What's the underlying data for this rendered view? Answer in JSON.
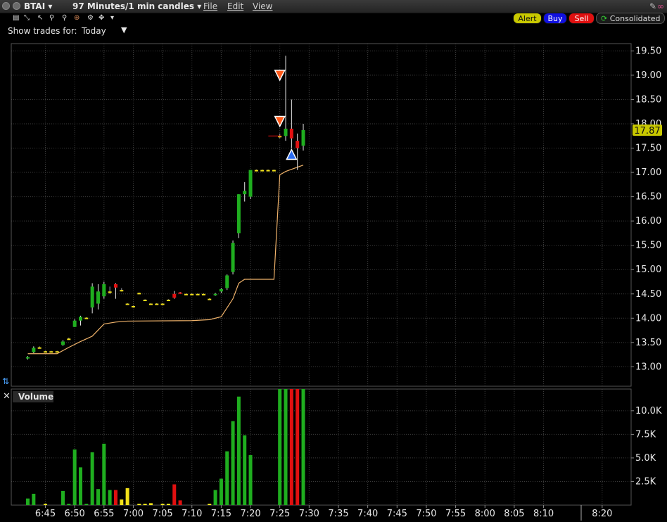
{
  "window": {
    "symbol": "BTAI",
    "period": "97 Minutes/1 min candles",
    "menus": [
      "File",
      "Edit",
      "View"
    ]
  },
  "actions": {
    "alert": "Alert",
    "buy": "Buy",
    "sell": "Sell",
    "consolidated": "Consolidated"
  },
  "show_trades": {
    "label": "Show trades for:",
    "value": "Today"
  },
  "volume_panel": {
    "title": "Volume"
  },
  "colors": {
    "up": "#1fae1f",
    "down": "#e01010",
    "flat": "#f2e11a",
    "vwap": "#f0b36b",
    "grid": "#3c3c3c",
    "alert_btn": "#c8c800",
    "buy_btn": "#1010e0",
    "sell_btn": "#e01010",
    "last_price_bg": "#c8c800"
  },
  "chart_data": [
    {
      "type": "candlestick",
      "title": "BTAI",
      "price_axis": {
        "ylim": [
          12.6,
          19.65
        ],
        "ticks": [
          "19.50",
          "19.00",
          "18.50",
          "18.00",
          "17.50",
          "17.00",
          "16.50",
          "16.00",
          "15.50",
          "15.00",
          "14.50",
          "14.00",
          "13.50",
          "13.00"
        ]
      },
      "last_price": "17.87",
      "time_axis": {
        "ticks": [
          "6:45",
          "6:50",
          "6:55",
          "7:00",
          "7:05",
          "7:10",
          "7:15",
          "7:20",
          "7:25",
          "7:30",
          "7:35",
          "7:40",
          "7:45",
          "7:50",
          "7:55",
          "8:00",
          "8:05",
          "8:10",
          "8:20"
        ]
      },
      "candles": [
        {
          "t": "6:42",
          "o": 13.17,
          "h": 13.22,
          "l": 13.15,
          "c": 13.2
        },
        {
          "t": "6:43",
          "o": 13.3,
          "h": 13.42,
          "l": 13.28,
          "c": 13.39
        },
        {
          "t": "6:44",
          "o": 13.4,
          "h": 13.42,
          "l": 13.38,
          "c": 13.4
        },
        {
          "t": "6:45",
          "o": 13.32,
          "h": 13.33,
          "l": 13.31,
          "c": 13.32
        },
        {
          "t": "6:46",
          "o": 13.32,
          "h": 13.33,
          "l": 13.31,
          "c": 13.32
        },
        {
          "t": "6:47",
          "o": 13.32,
          "h": 13.33,
          "l": 13.31,
          "c": 13.32
        },
        {
          "t": "6:48",
          "o": 13.45,
          "h": 13.55,
          "l": 13.43,
          "c": 13.52
        },
        {
          "t": "6:49",
          "o": 13.58,
          "h": 13.6,
          "l": 13.56,
          "c": 13.58
        },
        {
          "t": "6:50",
          "o": 13.82,
          "h": 13.98,
          "l": 13.82,
          "c": 13.95
        },
        {
          "t": "6:51",
          "o": 13.95,
          "h": 14.05,
          "l": 13.85,
          "c": 14.03
        },
        {
          "t": "6:52",
          "o": 14.01,
          "h": 14.02,
          "l": 14.0,
          "c": 14.01
        },
        {
          "t": "6:53",
          "o": 14.22,
          "h": 14.72,
          "l": 14.1,
          "c": 14.65
        },
        {
          "t": "6:54",
          "o": 14.3,
          "h": 14.7,
          "l": 14.18,
          "c": 14.55
        },
        {
          "t": "6:55",
          "o": 14.45,
          "h": 14.75,
          "l": 14.4,
          "c": 14.7
        },
        {
          "t": "6:56",
          "o": 14.55,
          "h": 14.65,
          "l": 14.5,
          "c": 14.55
        },
        {
          "t": "6:57",
          "o": 14.7,
          "h": 14.72,
          "l": 14.4,
          "c": 14.63
        },
        {
          "t": "6:58",
          "o": 14.58,
          "h": 14.62,
          "l": 14.55,
          "c": 14.58
        },
        {
          "t": "6:59",
          "o": 14.3,
          "h": 14.31,
          "l": 14.29,
          "c": 14.3
        },
        {
          "t": "7:00",
          "o": 14.25,
          "h": 14.26,
          "l": 14.24,
          "c": 14.25
        },
        {
          "t": "7:01",
          "o": 14.52,
          "h": 14.53,
          "l": 14.51,
          "c": 14.52
        },
        {
          "t": "7:02",
          "o": 14.38,
          "h": 14.39,
          "l": 14.37,
          "c": 14.38
        },
        {
          "t": "7:03",
          "o": 14.3,
          "h": 14.31,
          "l": 14.29,
          "c": 14.3
        },
        {
          "t": "7:04",
          "o": 14.3,
          "h": 14.31,
          "l": 14.29,
          "c": 14.3
        },
        {
          "t": "7:05",
          "o": 14.3,
          "h": 14.31,
          "l": 14.29,
          "c": 14.3
        },
        {
          "t": "7:06",
          "o": 14.38,
          "h": 14.39,
          "l": 14.37,
          "c": 14.38
        },
        {
          "t": "7:07",
          "o": 14.5,
          "h": 14.56,
          "l": 14.4,
          "c": 14.42
        },
        {
          "t": "7:08",
          "o": 14.53,
          "h": 14.54,
          "l": 14.5,
          "c": 14.51
        },
        {
          "t": "7:09",
          "o": 14.5,
          "h": 14.51,
          "l": 14.49,
          "c": 14.5
        },
        {
          "t": "7:10",
          "o": 14.5,
          "h": 14.51,
          "l": 14.49,
          "c": 14.5
        },
        {
          "t": "7:11",
          "o": 14.5,
          "h": 14.51,
          "l": 14.49,
          "c": 14.5
        },
        {
          "t": "7:12",
          "o": 14.5,
          "h": 14.51,
          "l": 14.49,
          "c": 14.5
        },
        {
          "t": "7:13",
          "o": 14.4,
          "h": 14.41,
          "l": 14.39,
          "c": 14.4
        },
        {
          "t": "7:14",
          "o": 14.48,
          "h": 14.52,
          "l": 14.46,
          "c": 14.5
        },
        {
          "t": "7:15",
          "o": 14.55,
          "h": 14.62,
          "l": 14.52,
          "c": 14.6
        },
        {
          "t": "7:16",
          "o": 14.62,
          "h": 14.9,
          "l": 14.58,
          "c": 14.88
        },
        {
          "t": "7:17",
          "o": 14.95,
          "h": 15.6,
          "l": 14.9,
          "c": 15.55
        },
        {
          "t": "7:18",
          "o": 15.75,
          "h": 16.55,
          "l": 15.65,
          "c": 16.55
        },
        {
          "t": "7:19",
          "o": 16.55,
          "h": 16.8,
          "l": 16.4,
          "c": 16.62
        },
        {
          "t": "7:20",
          "o": 16.5,
          "h": 17.05,
          "l": 16.45,
          "c": 17.05
        },
        {
          "t": "7:21",
          "o": 17.05,
          "h": 17.06,
          "l": 17.04,
          "c": 17.05
        },
        {
          "t": "7:22",
          "o": 17.05,
          "h": 17.06,
          "l": 17.04,
          "c": 17.05
        },
        {
          "t": "7:23",
          "o": 17.05,
          "h": 17.06,
          "l": 17.04,
          "c": 17.05
        },
        {
          "t": "7:24",
          "o": 17.05,
          "h": 17.06,
          "l": 17.04,
          "c": 17.05
        },
        {
          "t": "7:25",
          "o": 17.75,
          "h": 17.8,
          "l": 17.7,
          "c": 17.75
        },
        {
          "t": "7:26",
          "o": 17.75,
          "h": 19.4,
          "l": 17.65,
          "c": 17.9
        },
        {
          "t": "7:27",
          "o": 17.9,
          "h": 18.5,
          "l": 17.5,
          "c": 17.7
        },
        {
          "t": "7:28",
          "o": 17.65,
          "h": 17.8,
          "l": 17.05,
          "c": 17.5
        },
        {
          "t": "7:29",
          "o": 17.55,
          "h": 18.0,
          "l": 17.45,
          "c": 17.87
        }
      ],
      "vwap": [
        {
          "t": "6:42",
          "v": 13.27
        },
        {
          "t": "6:47",
          "v": 13.27
        },
        {
          "t": "6:49",
          "v": 13.4
        },
        {
          "t": "6:51",
          "v": 13.52
        },
        {
          "t": "6:53",
          "v": 13.63
        },
        {
          "t": "6:55",
          "v": 13.88
        },
        {
          "t": "6:57",
          "v": 13.92
        },
        {
          "t": "6:59",
          "v": 13.94
        },
        {
          "t": "7:10",
          "v": 13.95
        },
        {
          "t": "7:13",
          "v": 13.97
        },
        {
          "t": "7:15",
          "v": 14.03
        },
        {
          "t": "7:17",
          "v": 14.4
        },
        {
          "t": "7:18",
          "v": 14.72
        },
        {
          "t": "7:19",
          "v": 14.8
        },
        {
          "t": "7:24",
          "v": 14.8
        },
        {
          "t": "7:25",
          "v": 16.95
        },
        {
          "t": "7:26",
          "v": 17.02
        },
        {
          "t": "7:29",
          "v": 17.15
        }
      ],
      "trade_markers": [
        {
          "side": "sell",
          "t": "7:25",
          "price": 19.0
        },
        {
          "side": "sell",
          "t": "7:25",
          "price": 18.05
        },
        {
          "side": "buy",
          "t": "7:27",
          "price": 17.37
        }
      ]
    },
    {
      "type": "bar",
      "title": "Volume",
      "y_axis": {
        "ylim": [
          0,
          12300
        ],
        "ticks": [
          "10.0K",
          "7.5K",
          "5.0K",
          "2.5K"
        ]
      },
      "bars": [
        {
          "t": "6:42",
          "v": 700,
          "dir": "up"
        },
        {
          "t": "6:43",
          "v": 1200,
          "dir": "up"
        },
        {
          "t": "6:44",
          "v": 0,
          "dir": "up"
        },
        {
          "t": "6:45",
          "v": 150,
          "dir": "flat"
        },
        {
          "t": "6:46",
          "v": 0,
          "dir": "up"
        },
        {
          "t": "6:47",
          "v": 0,
          "dir": "up"
        },
        {
          "t": "6:48",
          "v": 1500,
          "dir": "up"
        },
        {
          "t": "6:49",
          "v": 150,
          "dir": "up"
        },
        {
          "t": "6:50",
          "v": 5900,
          "dir": "up"
        },
        {
          "t": "6:51",
          "v": 4000,
          "dir": "up"
        },
        {
          "t": "6:52",
          "v": 150,
          "dir": "up"
        },
        {
          "t": "6:53",
          "v": 5600,
          "dir": "up"
        },
        {
          "t": "6:54",
          "v": 1700,
          "dir": "up"
        },
        {
          "t": "6:55",
          "v": 6500,
          "dir": "up"
        },
        {
          "t": "6:56",
          "v": 1600,
          "dir": "up"
        },
        {
          "t": "6:57",
          "v": 1600,
          "dir": "down"
        },
        {
          "t": "6:58",
          "v": 600,
          "dir": "flat"
        },
        {
          "t": "6:59",
          "v": 1800,
          "dir": "flat"
        },
        {
          "t": "7:00",
          "v": 0,
          "dir": "up"
        },
        {
          "t": "7:01",
          "v": 150,
          "dir": "flat"
        },
        {
          "t": "7:02",
          "v": 150,
          "dir": "flat"
        },
        {
          "t": "7:03",
          "v": 200,
          "dir": "flat"
        },
        {
          "t": "7:04",
          "v": 0,
          "dir": "up"
        },
        {
          "t": "7:05",
          "v": 150,
          "dir": "flat"
        },
        {
          "t": "7:06",
          "v": 150,
          "dir": "flat"
        },
        {
          "t": "7:07",
          "v": 2200,
          "dir": "down"
        },
        {
          "t": "7:08",
          "v": 500,
          "dir": "down"
        },
        {
          "t": "7:09",
          "v": 0,
          "dir": "up"
        },
        {
          "t": "7:10",
          "v": 0,
          "dir": "up"
        },
        {
          "t": "7:11",
          "v": 0,
          "dir": "up"
        },
        {
          "t": "7:12",
          "v": 0,
          "dir": "up"
        },
        {
          "t": "7:13",
          "v": 150,
          "dir": "flat"
        },
        {
          "t": "7:14",
          "v": 1600,
          "dir": "up"
        },
        {
          "t": "7:15",
          "v": 2800,
          "dir": "up"
        },
        {
          "t": "7:16",
          "v": 5700,
          "dir": "up"
        },
        {
          "t": "7:17",
          "v": 8900,
          "dir": "up"
        },
        {
          "t": "7:18",
          "v": 11500,
          "dir": "up"
        },
        {
          "t": "7:19",
          "v": 7400,
          "dir": "up"
        },
        {
          "t": "7:20",
          "v": 5300,
          "dir": "up"
        },
        {
          "t": "7:21",
          "v": 0,
          "dir": "up"
        },
        {
          "t": "7:22",
          "v": 0,
          "dir": "up"
        },
        {
          "t": "7:23",
          "v": 0,
          "dir": "up"
        },
        {
          "t": "7:24",
          "v": 0,
          "dir": "up"
        },
        {
          "t": "7:25",
          "v": 12300,
          "dir": "up"
        },
        {
          "t": "7:26",
          "v": 12300,
          "dir": "up"
        },
        {
          "t": "7:27",
          "v": 12300,
          "dir": "down"
        },
        {
          "t": "7:28",
          "v": 12300,
          "dir": "down"
        },
        {
          "t": "7:29",
          "v": 12300,
          "dir": "up"
        }
      ]
    }
  ]
}
